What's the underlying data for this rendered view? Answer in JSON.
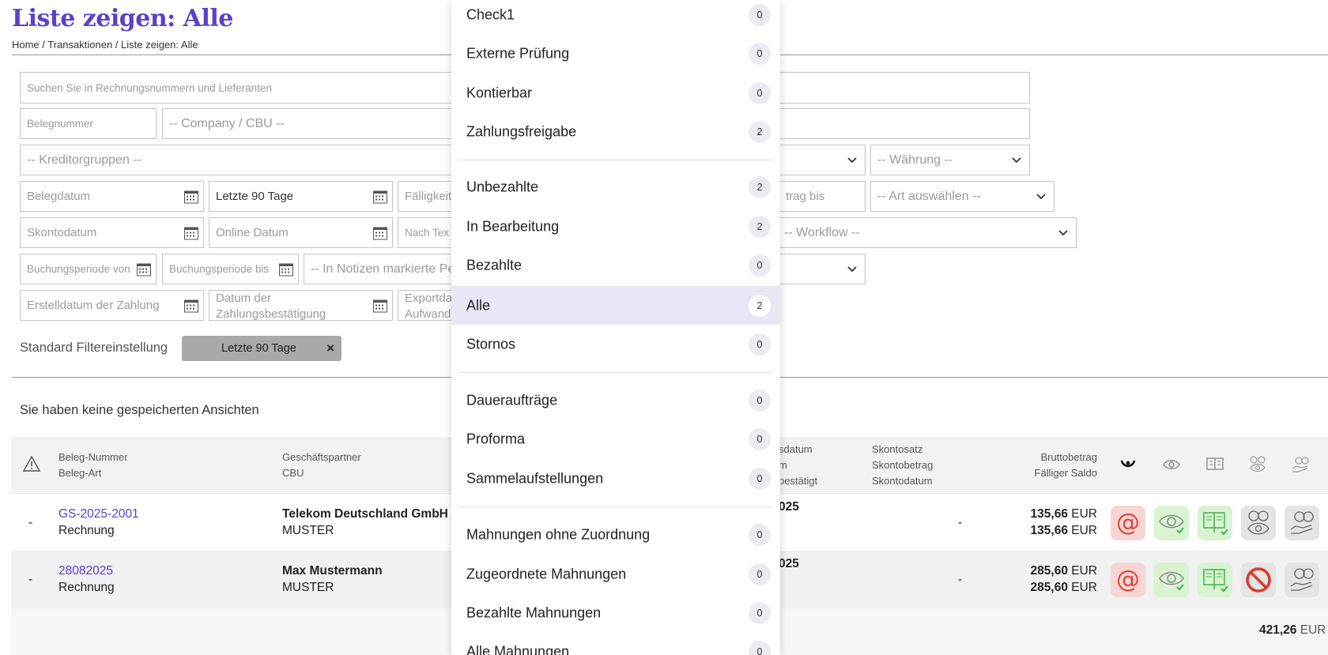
{
  "page": {
    "title": "Liste zeigen: Alle",
    "breadcrumb": "Home / Transaktionen / Liste zeigen: Alle"
  },
  "filters": {
    "search_placeholder": "Suchen Sie in Rechnungsnummern und Lieferanten",
    "belegnummer_placeholder": "Belegnummer",
    "company_placeholder": "-- Company / CBU --",
    "kreditorgruppen_placeholder": "-- Kreditorgruppen --",
    "waehrung_placeholder": "-- Währung --",
    "belegdatum_placeholder": "Belegdatum",
    "letzte90_value": "Letzte 90 Tage",
    "faelligkeit_placeholder": "Fälligkeit",
    "betrag_bis_placeholder": "trag bis",
    "art_placeholder": "-- Art auswählen --",
    "skontodatum_placeholder": "Skontodatum",
    "online_datum_placeholder": "Online Datum",
    "nach_text_placeholder": "Nach Tex",
    "workflow_placeholder": "-- Workflow --",
    "buchungsperiode_von_placeholder": "Buchungsperiode von",
    "buchungsperiode_bis_placeholder": "Buchungsperiode bis",
    "notizen_placeholder": "-- In Notizen markierte Pe",
    "erstelldatum_placeholder": "Erstelldatum der Zahlung",
    "zahlungsbest_placeholder_line1": "Datum der",
    "zahlungsbest_placeholder_line2": "Zahlungsbestätigung",
    "export_placeholder_line1": "Exportda",
    "export_placeholder_line2": "Aufwand",
    "standard_label": "Standard Filtereinstellung",
    "standard_tag": "Letzte 90 Tage",
    "tag_remove": "×"
  },
  "saved_views_text": "Sie haben keine gespeicherten Ansichten",
  "table": {
    "headers": {
      "beleg_nummer": "Beleg-Nummer",
      "beleg_art": "Beleg-Art",
      "geschaeftspartner": "Geschäftspartner",
      "cbu": "CBU",
      "date_1": "sdatum",
      "date_2": "m",
      "date_3": "bestätigt",
      "skontosatz": "Skontosatz",
      "skontobetrag": "Skontobetrag",
      "skontodatum": "Skontodatum",
      "bruttobetrag": "Bruttobetrag",
      "faelliger_saldo": "Fälliger Saldo"
    },
    "rows": [
      {
        "status": "-",
        "beleg_nummer": "GS-2025-2001",
        "beleg_art": "Rechnung",
        "partner": "Telekom Deutschland GmbH",
        "cbu": "MUSTER",
        "date": "025",
        "skonto": "-",
        "brutto": "135,66",
        "saldo": "135,66",
        "currency": "EUR"
      },
      {
        "status": "-",
        "beleg_nummer": "28082025",
        "beleg_art": "Rechnung",
        "partner": "Max Mustermann",
        "cbu": "MUSTER",
        "date": "025",
        "skonto": "-",
        "brutto": "285,60",
        "saldo": "285,60",
        "currency": "EUR"
      }
    ],
    "total": "421,26",
    "total_currency": "EUR /"
  },
  "dropdown": {
    "groups": [
      [
        {
          "label": "Check1",
          "count": "0"
        },
        {
          "label": "Externe Prüfung",
          "count": "0"
        },
        {
          "label": "Kontierbar",
          "count": "0"
        },
        {
          "label": "Zahlungsfreigabe",
          "count": "2"
        }
      ],
      [
        {
          "label": "Unbezahlte",
          "count": "2"
        },
        {
          "label": "In Bearbeitung",
          "count": "2"
        },
        {
          "label": "Bezahlte",
          "count": "0"
        },
        {
          "label": "Alle",
          "count": "2",
          "active": true
        },
        {
          "label": "Stornos",
          "count": "0"
        }
      ],
      [
        {
          "label": "Daueraufträge",
          "count": "0"
        },
        {
          "label": "Proforma",
          "count": "0"
        },
        {
          "label": "Sammelaufstellungen",
          "count": "0"
        }
      ],
      [
        {
          "label": "Mahnungen ohne Zuordnung",
          "count": "0"
        },
        {
          "label": "Zugeordnete Mahnungen",
          "count": "0"
        },
        {
          "label": "Bezahlte Mahnungen",
          "count": "0"
        },
        {
          "label": "Alle Mahnungen",
          "count": "0"
        }
      ]
    ]
  },
  "colors": {
    "accent": "#5c40c9",
    "active_item_bg": "#e9e6f6",
    "email_action_bg": "#f6d6d5",
    "ok_action_bg": "#d9f3d3",
    "neutral_action_bg": "#e4e4e4",
    "tag_bg": "#a9a9a9"
  },
  "icons": {
    "action_header": [
      "post-horn-icon",
      "eye-icon",
      "book-icon",
      "money-eye-icon",
      "money-hand-icon"
    ],
    "row_actions": [
      "email-icon",
      "eye-check-icon",
      "book-check-icon",
      "money-eye-icon",
      "money-hand-icon"
    ],
    "row2_blocked": "blocked-icon",
    "warning": "warning-triangle-icon",
    "calendar": "calendar-icon",
    "chevron": "chevron-down-icon"
  }
}
